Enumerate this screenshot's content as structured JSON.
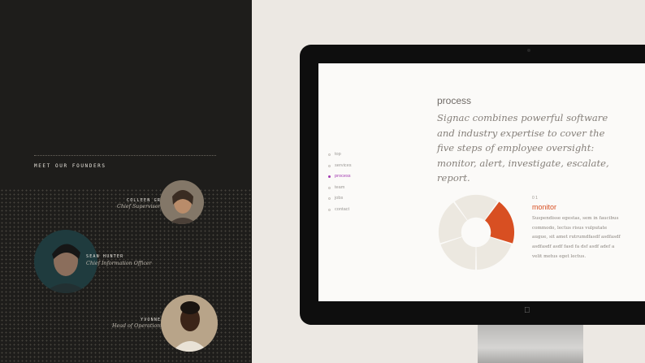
{
  "founders_panel": {
    "heading": "MEET OUR FOUNDERS",
    "founders": [
      {
        "name": "COLLEEN GRAHAM",
        "role": "Chief Supervisory Officer",
        "avatar_icon": "portrait-photo-woman"
      },
      {
        "name": "SEAN HUNTER",
        "role": "Chief Information Officer",
        "avatar_icon": "portrait-photo-man"
      },
      {
        "name": "YVONNE WANG",
        "role": "Head of Operations",
        "avatar_icon": "portrait-photo-woman"
      }
    ]
  },
  "site": {
    "nav": [
      {
        "label": "top",
        "active": false
      },
      {
        "label": "services",
        "active": false
      },
      {
        "label": "process",
        "active": true
      },
      {
        "label": "team",
        "active": false
      },
      {
        "label": "jobs",
        "active": false
      },
      {
        "label": "contact",
        "active": false
      }
    ],
    "section_title": "process",
    "intro": "Signac combines powerful software and industry expertise to cover the five steps of employee oversight: monitor, alert, investigate, escalate, report.",
    "step": {
      "number": "0 1",
      "title": "monitor",
      "body": "Suspendisse egestas, sem in faucibus commodo, lectus risus vulputate augue, sit amet rutrumdfasdf asdfasdf asdfasdf asdf fasd fa dsf asdf adef a velit metus eget lectus."
    },
    "donut": {
      "segments": 5,
      "highlighted_segment": 1,
      "highlight_color": "#d84f22",
      "base_color": "#ece8e0"
    }
  },
  "colors": {
    "left_bg": "#1e1d1b",
    "right_bg": "#ece8e3",
    "accent_nav": "#a23ab0",
    "accent_step": "#d84f22"
  },
  "device": {
    "logo_icon": "apple-logo-icon"
  }
}
